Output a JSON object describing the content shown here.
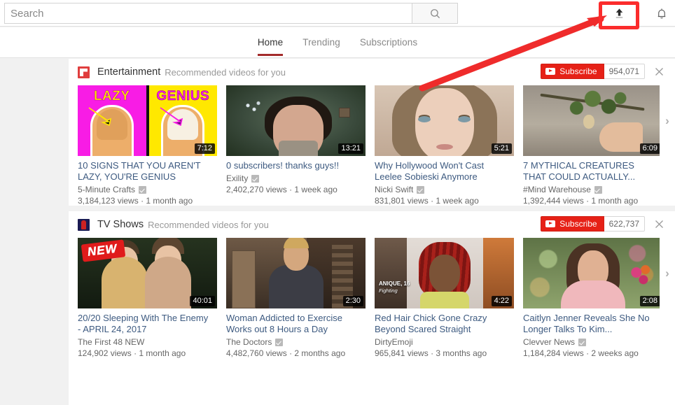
{
  "masthead": {
    "search_placeholder": "Search",
    "search_value": "",
    "search_icon": "magnifier-icon",
    "upload_icon": "upload-icon",
    "notifications_icon": "bell-icon"
  },
  "nav": {
    "tabs": [
      {
        "label": "Home",
        "active": true
      },
      {
        "label": "Trending",
        "active": false
      },
      {
        "label": "Subscriptions",
        "active": false
      }
    ]
  },
  "annotation": {
    "highlight_color": "#fb2c2c",
    "arrow_color": "#ef2b2b",
    "target": "upload-button"
  },
  "shelves": [
    {
      "id": "entertainment",
      "avatar_icon": "entertainment-category-icon",
      "title": "Entertainment",
      "subtitle": "Recommended videos for you",
      "subscribe_label": "Subscribe",
      "subscriber_count": "954,071",
      "dismiss_icon": "close-icon",
      "next_icon": "chevron-right-icon",
      "videos": [
        {
          "title": "10 SIGNS THAT YOU AREN'T LAZY, YOU'RE GENIUS",
          "channel": "5-Minute Crafts",
          "verified": true,
          "views": "3,184,123 views",
          "age": "1 month ago",
          "duration": "7:12",
          "thumb_overlay_left": "LAZY",
          "thumb_overlay_right": "GENIUS"
        },
        {
          "title": "0 subscribers! thanks guys!!",
          "channel": "Exility",
          "verified": true,
          "views": "2,402,270 views",
          "age": "1 week ago",
          "duration": "13:21"
        },
        {
          "title": "Why Hollywood Won't Cast Leelee Sobieski Anymore",
          "channel": "Nicki Swift",
          "verified": true,
          "views": "831,801 views",
          "age": "1 week ago",
          "duration": "5:21"
        },
        {
          "title": "7 MYTHICAL CREATURES THAT COULD ACTUALLY...",
          "channel": "#Mind Warehouse",
          "verified": true,
          "views": "1,392,444 views",
          "age": "1 month ago",
          "duration": "6:09"
        }
      ]
    },
    {
      "id": "tv-shows",
      "avatar_icon": "tv-shows-category-icon",
      "title": "TV Shows",
      "subtitle": "Recommended videos for you",
      "subscribe_label": "Subscribe",
      "subscriber_count": "622,737",
      "dismiss_icon": "close-icon",
      "next_icon": "chevron-right-icon",
      "videos": [
        {
          "title": "20/20 Sleeping With The Enemy - APRIL 24, 2017",
          "channel": "The First 48 NEW",
          "verified": false,
          "views": "124,902 views",
          "age": "1 month ago",
          "duration": "40:01",
          "thumb_badge": "NEW"
        },
        {
          "title": "Woman Addicted to Exercise Works out 8 Hours a Day",
          "channel": "The Doctors",
          "verified": true,
          "views": "4,482,760 views",
          "age": "2 months ago",
          "duration": "2:30"
        },
        {
          "title": "Red Hair Chick Gone Crazy Beyond Scared Straight",
          "channel": "DirtyEmoji",
          "verified": false,
          "views": "965,841 views",
          "age": "3 months ago",
          "duration": "4:22",
          "thumb_caption_name": "ANIQUE, 16",
          "thumb_caption_role": "Fighting"
        },
        {
          "title": "Caitlyn Jenner Reveals She No Longer Talks To Kim...",
          "channel": "Clevver News",
          "verified": true,
          "views": "1,184,284 views",
          "age": "2 weeks ago",
          "duration": "2:08"
        }
      ]
    }
  ]
}
